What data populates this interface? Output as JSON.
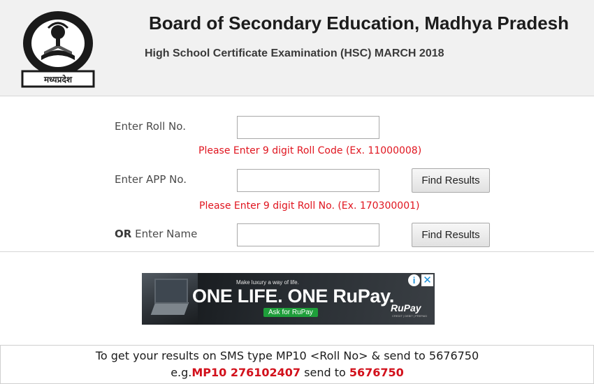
{
  "header": {
    "logo_text": "मध्यप्रदेश",
    "board_title": "Board of Secondary Education, Madhya Pradesh",
    "exam_title": "High School Certificate Examination (HSC) MARCH 2018"
  },
  "form": {
    "roll_label": "Enter Roll No.",
    "roll_value": "",
    "roll_hint": "Please Enter 9 digit Roll Code (Ex. 11000008)",
    "app_label": "Enter APP No.",
    "app_value": "",
    "app_hint": "Please Enter 9 digit Roll No. (Ex. 170300001)",
    "or_text": "OR",
    "name_label": "Enter Name",
    "name_value": "",
    "find_button_label": "Find Results"
  },
  "ad": {
    "tagline": "Make luxury a way of life.",
    "headline": "ONE LIFE. ONE RuPay.",
    "cta": "Ask for RuPay",
    "brand": "RuPay",
    "brand_sub": "CREDIT | DEBIT | PREPAID",
    "info_icon": "info-icon",
    "close_icon": "close-icon"
  },
  "sms": {
    "line1": "To get your results on SMS type MP10 <Roll No> & send to 5676750",
    "line2_prefix": "e.g.",
    "line2_code": "MP10 276102407",
    "line2_middle": " send to ",
    "line2_number": "5676750"
  },
  "colors": {
    "hint_red": "#e0141e",
    "header_bg": "#f1f1f1",
    "cta_green": "#1e9e3a"
  }
}
